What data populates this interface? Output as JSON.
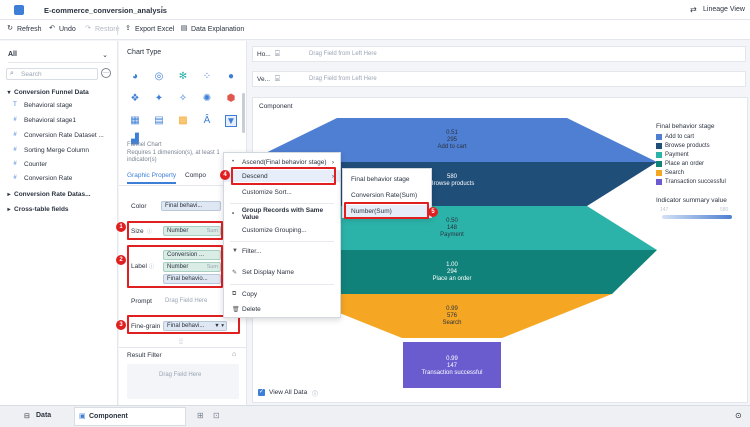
{
  "app": {
    "title": "E-commerce_conversion_analysis",
    "more_glyph": "⋮",
    "lineage_label": "Lineage View"
  },
  "toolbar": {
    "refresh": "Refresh",
    "undo": "Undo",
    "restore": "Restore",
    "export": "Export Excel",
    "explain": "Data Explanation"
  },
  "left_panel": {
    "dataset_select": "All",
    "search_placeholder": "Search",
    "groups": [
      {
        "label": "Conversion Funnel Data"
      },
      {
        "label": "Conversion Rate Datas..."
      },
      {
        "label": "Cross-table fields"
      }
    ],
    "fields": [
      {
        "icon": "T",
        "label": "Behavioral stage"
      },
      {
        "icon": "#",
        "label": "Behavioral stage1"
      },
      {
        "icon": "#",
        "label": "Conversion Rate Dataset ..."
      },
      {
        "icon": "#",
        "label": "Sorting Merge Column"
      },
      {
        "icon": "#",
        "label": "Counter"
      },
      {
        "icon": "#",
        "label": "Conversion Rate"
      }
    ]
  },
  "middle_panel": {
    "chart_type_label": "Chart Type",
    "funnel_title": "Funnel Chart",
    "funnel_desc": "Requires 1 dimension(s), at least 1 indicator(s)",
    "tabs": [
      "Graphic Property",
      "Compo"
    ],
    "color_label": "Color",
    "color_pill": "Final behavi...",
    "size_label": "Size",
    "size_pill": "Number",
    "size_hint": "Sum",
    "label_label": "Label",
    "label_pills": [
      {
        "text": "Conversion ...",
        "hint": ""
      },
      {
        "text": "Number",
        "hint": "Sum"
      },
      {
        "text": "Final behavio...",
        "hint": ""
      }
    ],
    "prompt_label": "Prompt",
    "prompt_hint": "Drag Field Here",
    "fine_label": "Fine-grain",
    "fine_pill": "Final behavi...",
    "result_filter": "Result Filter",
    "result_hint": "Drag Field Here"
  },
  "fields_area": {
    "h_label": "Ho...",
    "v_label": "Ve...",
    "drag_hint": "Drag Field from Left Here"
  },
  "component_label": "Component",
  "view_all": "View All Data",
  "context_menu": {
    "items": [
      {
        "label": "Ascend(Final behavior stage)",
        "arrow": "›"
      },
      {
        "label": "Descend",
        "arrow": "›"
      },
      {
        "label": "Customize Sort..."
      },
      {
        "label": "Group Records with Same Value"
      },
      {
        "label": "Customize Grouping..."
      },
      {
        "label": "Filter..."
      },
      {
        "label": "Set Display Name"
      },
      {
        "label": "Copy"
      },
      {
        "label": "Delete"
      }
    ]
  },
  "submenu": {
    "items": [
      "Final behavior stage",
      "Conversion Rate(Sum)",
      "Number(Sum)"
    ]
  },
  "badges": [
    "1",
    "2",
    "3",
    "4",
    "5"
  ],
  "chart_data": {
    "type": "funnel",
    "categories": [
      "Add to cart",
      "Browse products",
      "Payment",
      "Place an order",
      "Search",
      "Transaction successful"
    ],
    "rates": [
      "0.51",
      "",
      "0.50",
      "1.00",
      "0.99",
      "0.99"
    ],
    "numbers": [
      "295",
      "580",
      "148",
      "294",
      "576",
      "147"
    ],
    "colors": [
      "#4f7fd2",
      "#1f4e79",
      "#2bb3a9",
      "#10827a",
      "#f5a623",
      "#6a5ccf"
    ],
    "legend_title": "Final behavior stage",
    "indicator_title": "Indicator summary value",
    "indicator_min": "147",
    "indicator_max": "580"
  },
  "bottom_tabs": {
    "data": "Data",
    "component": "Component"
  }
}
